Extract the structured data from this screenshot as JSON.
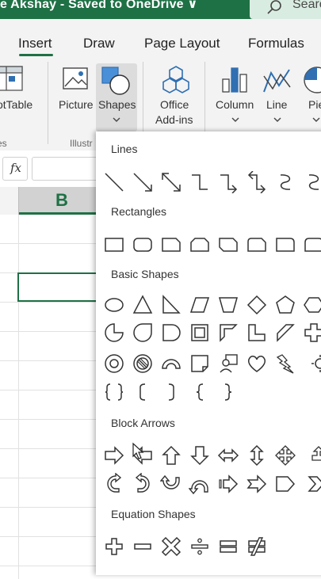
{
  "titlebar": {
    "title": "e Akshay  -  Saved to OneDrive ∨",
    "search_text": "Searc",
    "color": "#1e7145"
  },
  "tabs": [
    {
      "label": "Insert",
      "active": true
    },
    {
      "label": "Draw"
    },
    {
      "label": "Page Layout"
    },
    {
      "label": "Formulas"
    }
  ],
  "ribbon": {
    "pivot_label": "otTable",
    "tables_group": "es",
    "picture_label": "Picture",
    "shapes_label": "Shapes",
    "illustrations_group": "Illustr",
    "office_addins_line1": "Office",
    "office_addins_line2": "Add-ins",
    "column_label": "Column",
    "line_label": "Line",
    "pie_label": "Pie"
  },
  "formula_bar": {
    "fx": "fx"
  },
  "grid": {
    "column_header": "B"
  },
  "shapes_menu": {
    "sections": [
      {
        "title": "Lines"
      },
      {
        "title": "Rectangles"
      },
      {
        "title": "Basic Shapes"
      },
      {
        "title": "Block Arrows"
      },
      {
        "title": "Equation Shapes"
      }
    ]
  }
}
